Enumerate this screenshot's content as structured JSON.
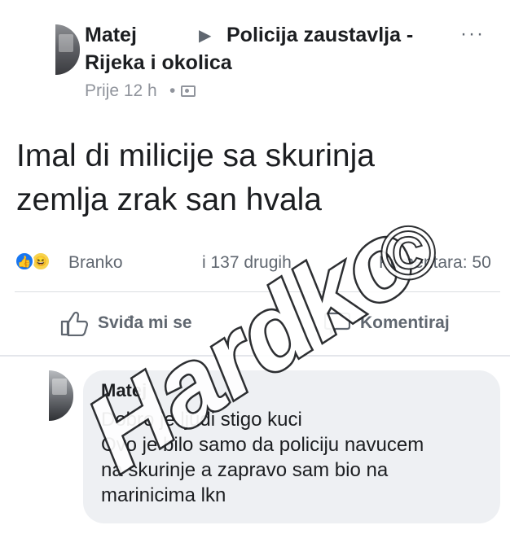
{
  "post": {
    "author": "Matej",
    "group_line1": "Policija zaustavlja -",
    "group_line2": "Rijeka i okolica",
    "time": "Prije 12 h",
    "separator": "•",
    "more": "···",
    "text": "Imal di milicije sa skurinja\nzemlja zrak san hvala"
  },
  "reactions": {
    "names": "Branko",
    "others": "i 137 drugih",
    "comments": "Komentara: 50",
    "like_glyph": "👍",
    "haha_glyph": "😆"
  },
  "actions": {
    "like_label": "Sviđa mi se",
    "comment_label": "Komentiraj"
  },
  "comment": {
    "author": "Matej",
    "text": "Dobro je ljudi stigo kuci\nOvo je bilo samo da policiju navucem\nna skurinje a zapravo sam bio na\nmarinicima lkn"
  },
  "watermark": {
    "text": "Hardko",
    "symbol": "©"
  },
  "colors": {
    "text": "#1c1e21",
    "secondary": "#606770",
    "meta": "#90949c",
    "like_blue": "#1877f2",
    "bubble": "#eef0f3"
  }
}
